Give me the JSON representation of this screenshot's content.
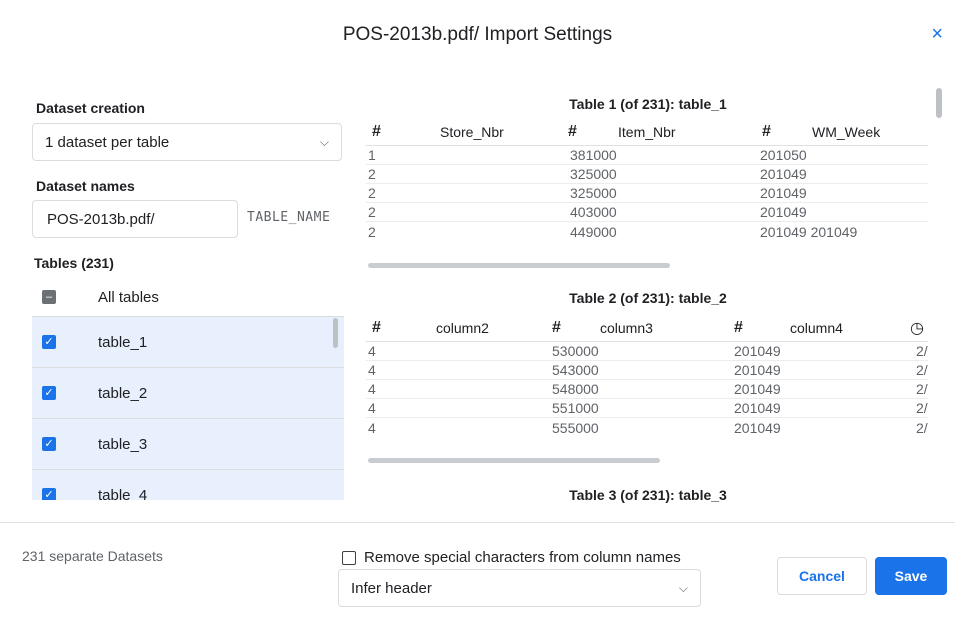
{
  "dialog": {
    "title": "POS-2013b.pdf/ Import Settings",
    "close_icon": "×"
  },
  "left": {
    "dataset_creation_label": "Dataset creation",
    "dataset_creation_value": "1 dataset per table",
    "dataset_names_label": "Dataset names",
    "dataset_name_prefix": "POS-2013b.pdf/",
    "dataset_name_suffix": "TABLE_NAME",
    "tables_label": "Tables (231)",
    "all_tables_label": "All tables",
    "tables": [
      {
        "label": "table_1",
        "checked": true
      },
      {
        "label": "table_2",
        "checked": true
      },
      {
        "label": "table_3",
        "checked": true
      },
      {
        "label": "table_4",
        "checked": true
      }
    ]
  },
  "preview": {
    "tables": [
      {
        "title": "Table 1 (of 231): table_1",
        "columns": [
          {
            "icon": "#",
            "name": "Store_Nbr"
          },
          {
            "icon": "#",
            "name": "Item_Nbr"
          },
          {
            "icon": "#",
            "name": "WM_Week"
          }
        ],
        "rows": [
          [
            "1",
            "381000",
            "201050"
          ],
          [
            "2",
            "325000",
            "201049"
          ],
          [
            "2",
            "325000",
            "201049"
          ],
          [
            "2",
            "403000",
            "201049"
          ],
          [
            "2",
            "449000",
            "201049 201049"
          ]
        ]
      },
      {
        "title": "Table 2 (of 231): table_2",
        "columns": [
          {
            "icon": "#",
            "name": "column2"
          },
          {
            "icon": "#",
            "name": "column3"
          },
          {
            "icon": "#",
            "name": "column4"
          },
          {
            "icon": "◷",
            "name": ""
          }
        ],
        "rows": [
          [
            "4",
            "530000",
            "201049",
            "2/"
          ],
          [
            "4",
            "543000",
            "201049",
            "2/"
          ],
          [
            "4",
            "548000",
            "201049",
            "2/"
          ],
          [
            "4",
            "551000",
            "201049",
            "2/"
          ],
          [
            "4",
            "555000",
            "201049",
            "2/"
          ]
        ]
      },
      {
        "title": "Table 3 (of 231): table_3"
      }
    ]
  },
  "footer": {
    "count_text": "231 separate Datasets",
    "remove_special_label": "Remove special characters from column names",
    "header_option": "Infer header",
    "cancel_label": "Cancel",
    "save_label": "Save"
  },
  "colors": {
    "accent": "#1a73e8",
    "selected_row_bg": "#e8f0fe"
  }
}
